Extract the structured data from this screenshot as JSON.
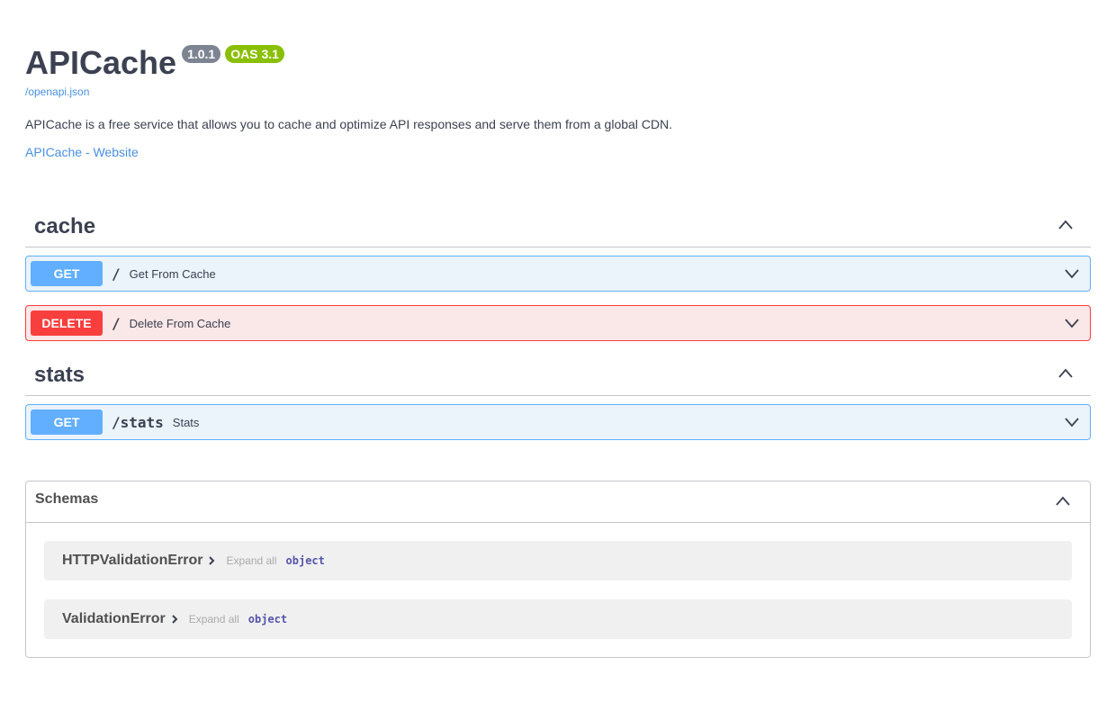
{
  "info": {
    "title": "APICache",
    "version": "1.0.1",
    "oas": "OAS 3.1",
    "spec_link": "/openapi.json",
    "description": "APICache is a free service that allows you to cache and optimize API responses and serve them from a global CDN.",
    "website_link": "APICache - Website"
  },
  "tags": [
    {
      "name": "cache",
      "operations": [
        {
          "method": "GET",
          "path": "/",
          "summary": "Get From Cache"
        },
        {
          "method": "DELETE",
          "path": "/",
          "summary": "Delete From Cache"
        }
      ]
    },
    {
      "name": "stats",
      "operations": [
        {
          "method": "GET",
          "path": "/stats",
          "summary": "Stats"
        }
      ]
    }
  ],
  "schemas": {
    "title": "Schemas",
    "models": [
      {
        "name": "HTTPValidationError",
        "expand_label": "Expand all",
        "type": "object"
      },
      {
        "name": "ValidationError",
        "expand_label": "Expand all",
        "type": "object"
      }
    ]
  },
  "colors": {
    "get": "#61affe",
    "delete": "#f93e3e",
    "link": "#4990e2",
    "oas_badge": "#89bf04",
    "version_badge": "#7d8492"
  }
}
